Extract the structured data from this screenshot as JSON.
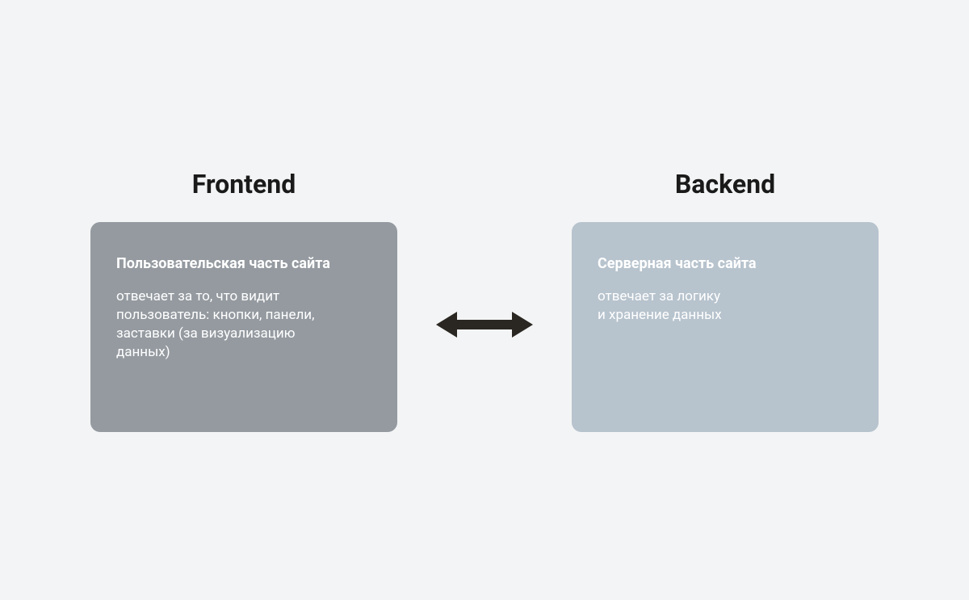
{
  "frontend": {
    "heading": "Frontend",
    "title": "Пользовательская часть сайта",
    "description": "отвечает за то, что видит\nпользователь: кнопки, панели,\nзаставки (за визуализацию\nданных)"
  },
  "backend": {
    "heading": "Backend",
    "title": "Серверная часть сайта",
    "description": "отвечает за логику\nи хранение данных"
  },
  "colors": {
    "page_bg": "#f3f4f5",
    "frontend_card": "#949aa0",
    "backend_card": "#b7c3cd",
    "arrow": "#2a2621"
  }
}
